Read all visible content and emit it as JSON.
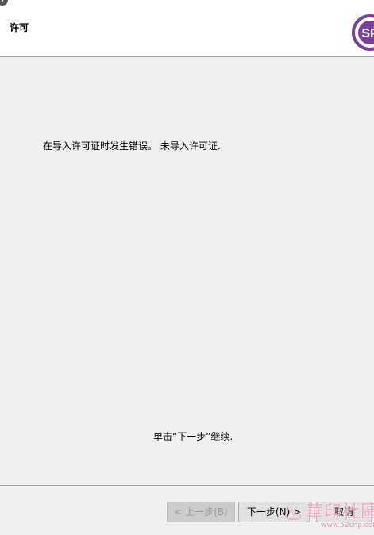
{
  "header": {
    "title": "许可",
    "info_icon_glyph": "i",
    "logo_text": "SP",
    "logo_color": "#7b3f9a"
  },
  "main": {
    "error_message": "在导入许可证时发生错误。   未导入许可证.",
    "continue_message": "单击“下一步”继续."
  },
  "footer": {
    "back_label": "< 上一步(B)",
    "next_label": "下一步(N) >",
    "cancel_label": "取消"
  },
  "watermark": {
    "title": "華印社區",
    "url": "www.52cnp.com"
  },
  "colors": {
    "header_bg": "#ffffff",
    "body_bg": "#f0f0f0",
    "disabled_text": "#9a9a9a"
  }
}
